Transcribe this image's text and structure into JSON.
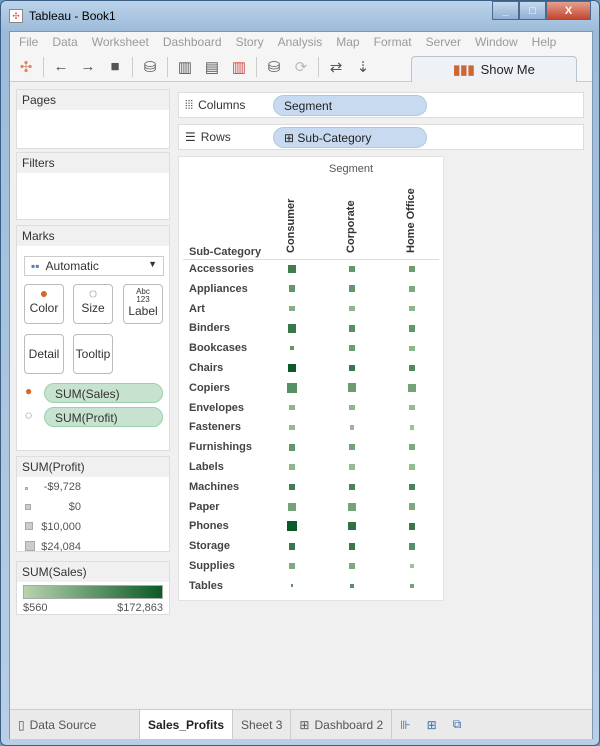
{
  "window": {
    "title": "Tableau - Book1",
    "minimize": "_",
    "maximize": "□",
    "close": "X"
  },
  "menu": [
    "File",
    "Data",
    "Worksheet",
    "Dashboard",
    "Story",
    "Analysis",
    "Map",
    "Format",
    "Server",
    "Window",
    "Help"
  ],
  "toolbar": {
    "show_me": "Show Me"
  },
  "panels": {
    "pages": "Pages",
    "filters": "Filters",
    "marks": "Marks",
    "mark_type": "Automatic",
    "mark_buttons": {
      "color": "Color",
      "size": "Size",
      "label": "Label",
      "label_glyph": "Abc\n123",
      "detail": "Detail",
      "tooltip": "Tooltip"
    },
    "mark_fields": [
      {
        "icon": "color-icon",
        "label": "SUM(Sales)"
      },
      {
        "icon": "size-icon",
        "label": "SUM(Profit)"
      }
    ]
  },
  "size_legend": {
    "title": "SUM(Profit)",
    "items": [
      "-$9,728",
      "$0",
      "$10,000",
      "$24,084"
    ]
  },
  "color_legend": {
    "title": "SUM(Sales)",
    "min": "$560",
    "max": "$172,863",
    "colors": [
      "#b9d3ad",
      "#0b5a27"
    ]
  },
  "shelves": {
    "columns_label": "Columns",
    "columns_pill": "Segment",
    "rows_label": "Rows",
    "rows_pill": "Sub-Category"
  },
  "chart_data": {
    "type": "heatmap",
    "column_header": "Segment",
    "row_header": "Sub-Category",
    "columns": [
      "Consumer",
      "Corporate",
      "Home Office"
    ],
    "rows": [
      "Accessories",
      "Appliances",
      "Art",
      "Binders",
      "Bookcases",
      "Chairs",
      "Copiers",
      "Envelopes",
      "Fasteners",
      "Furnishings",
      "Labels",
      "Machines",
      "Paper",
      "Phones",
      "Storage",
      "Supplies",
      "Tables"
    ],
    "size_measure": "SUM(Profit)",
    "color_measure": "SUM(Sales)",
    "profit_level": [
      [
        0.8,
        0.6,
        0.6
      ],
      [
        0.6,
        0.6,
        0.5
      ],
      [
        0.4,
        0.4,
        0.4
      ],
      [
        0.8,
        0.6,
        0.6
      ],
      [
        0.3,
        0.5,
        0.4
      ],
      [
        0.7,
        0.6,
        0.6
      ],
      [
        1,
        0.85,
        0.75
      ],
      [
        0.4,
        0.4,
        0.4
      ],
      [
        0.4,
        0.3,
        0.3
      ],
      [
        0.6,
        0.5,
        0.5
      ],
      [
        0.4,
        0.4,
        0.4
      ],
      [
        0.5,
        0.5,
        0.5
      ],
      [
        0.75,
        0.75,
        0.6
      ],
      [
        1,
        0.75,
        0.6
      ],
      [
        0.6,
        0.6,
        0.6
      ],
      [
        0.4,
        0.5,
        0.3
      ],
      [
        0.1,
        0.3,
        0.3
      ]
    ],
    "sales_level": [
      [
        0.7,
        0.5,
        0.45
      ],
      [
        0.5,
        0.5,
        0.35
      ],
      [
        0.3,
        0.25,
        0.25
      ],
      [
        0.75,
        0.55,
        0.5
      ],
      [
        0.5,
        0.45,
        0.25
      ],
      [
        1,
        0.75,
        0.6
      ],
      [
        0.55,
        0.45,
        0.4
      ],
      [
        0.25,
        0.25,
        0.2
      ],
      [
        0.2,
        0.2,
        0.15
      ],
      [
        0.5,
        0.4,
        0.35
      ],
      [
        0.25,
        0.2,
        0.2
      ],
      [
        0.7,
        0.65,
        0.65
      ],
      [
        0.4,
        0.4,
        0.35
      ],
      [
        1,
        0.8,
        0.75
      ],
      [
        0.75,
        0.75,
        0.55
      ],
      [
        0.35,
        0.35,
        0.15
      ],
      [
        0.5,
        0.55,
        0.4
      ]
    ]
  },
  "tabs": [
    {
      "label": "Data Source",
      "icon": "database-icon"
    },
    {
      "label": "Sales_Profits",
      "active": true
    },
    {
      "label": "Sheet 3"
    },
    {
      "label": "Dashboard 2",
      "icon": "dashboard-icon"
    }
  ]
}
